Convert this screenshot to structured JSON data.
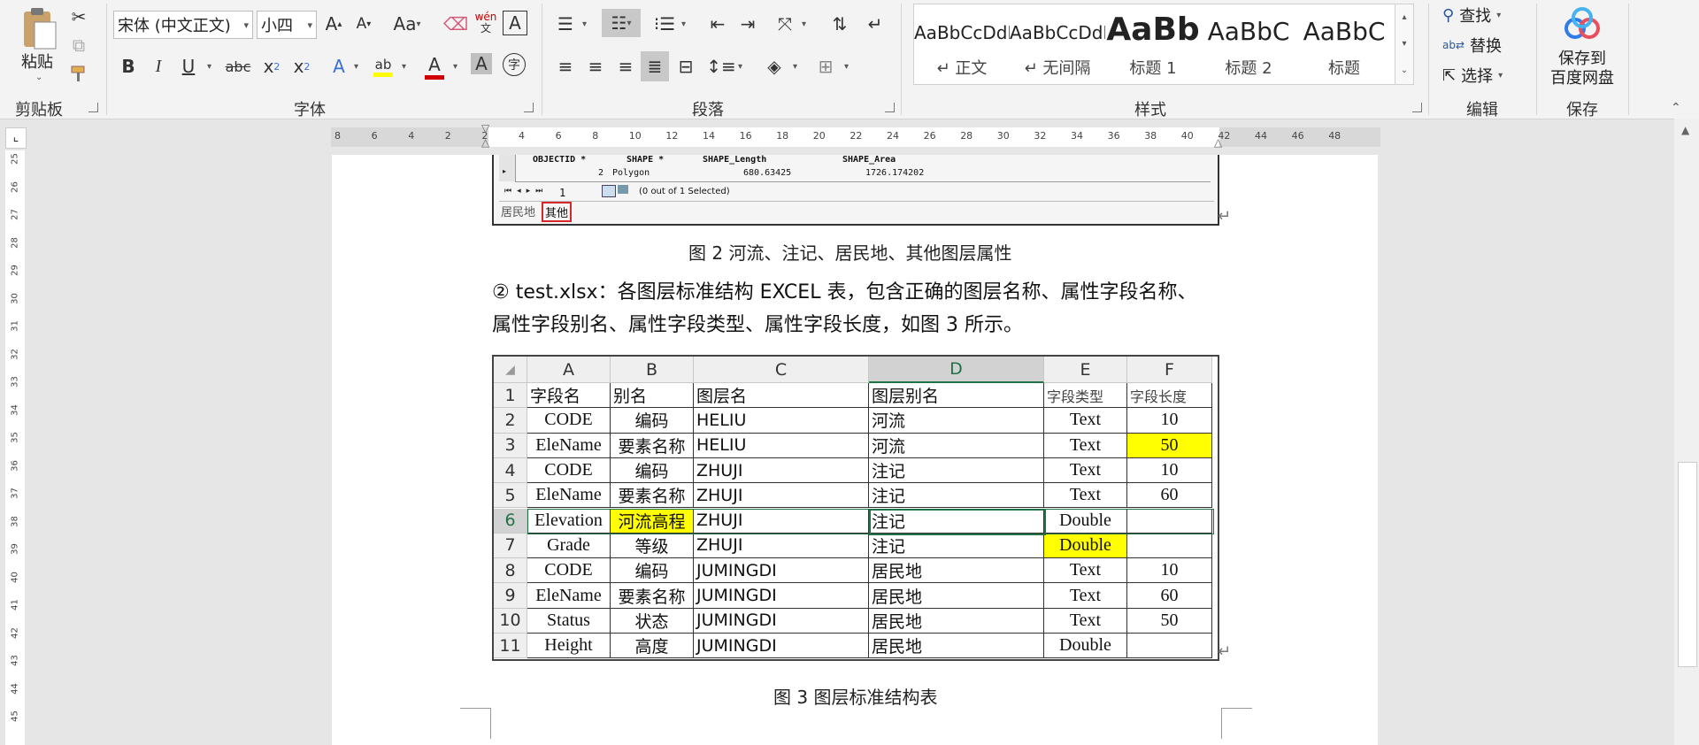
{
  "ribbon": {
    "clipboard": {
      "paste": "粘贴",
      "label": "剪贴板"
    },
    "font": {
      "name": "宋体 (中文正文)",
      "size": "小四",
      "label": "字体",
      "grow": "A",
      "shrink": "A",
      "case": "Aa",
      "phonetic": "wén",
      "border_char": "A",
      "bold": "B",
      "italic": "I",
      "underline": "U",
      "strike": "abc",
      "sub": "x",
      "sub_index": "2",
      "sup": "x",
      "sup_index": "2",
      "text_effect": "A",
      "highlight": "ab",
      "font_color": "A",
      "shading": "A",
      "enclose": "字"
    },
    "paragraph": {
      "label": "段落"
    },
    "styles": {
      "label": "样式",
      "items": [
        {
          "sample": "AaBbCcDdI",
          "name": "↵ 正文"
        },
        {
          "sample": "AaBbCcDdI",
          "name": "↵ 无间隔"
        },
        {
          "sample": "AaBb",
          "name": "标题 1"
        },
        {
          "sample": "AaBbC",
          "name": "标题 2"
        },
        {
          "sample": "AaBbC",
          "name": "标题"
        }
      ]
    },
    "editing": {
      "label": "编辑",
      "find": "查找",
      "replace": "替换",
      "select": "选择"
    },
    "save": {
      "label": "保存",
      "button_line1": "保存到",
      "button_line2": "百度网盘"
    }
  },
  "ruler": {
    "h_ticks": [
      "8",
      "6",
      "4",
      "2",
      "2",
      "4",
      "6",
      "8",
      "10",
      "12",
      "14",
      "16",
      "18",
      "20",
      "22",
      "24",
      "26",
      "28",
      "30",
      "32",
      "34",
      "36",
      "38",
      "40",
      "42",
      "44",
      "46",
      "48"
    ],
    "v_ticks": [
      "25",
      "26",
      "27",
      "28",
      "29",
      "30",
      "31",
      "32",
      "33",
      "34",
      "35",
      "36",
      "37",
      "38",
      "39",
      "40",
      "41",
      "42",
      "43",
      "44",
      "45"
    ]
  },
  "gis_table": {
    "headers": [
      "OBJECTID *",
      "SHAPE *",
      "SHAPE_Length",
      "SHAPE_Area"
    ],
    "row": [
      "2",
      "Polygon",
      "680.63425",
      "1726.174202"
    ],
    "nav_page": "1",
    "selection": "(0 out of 1 Selected)",
    "tabs": [
      "居民地",
      "其他"
    ]
  },
  "document": {
    "caption2": "图 2  河流、注记、居民地、其他图层属性",
    "para_line1": "② test.xlsx：各图层标准结构 EXCEL 表，包含正确的图层名称、属性字段名称、",
    "para_line2": "属性字段别名、属性字段类型、属性字段长度，如图 3 所示。",
    "caption3": "图 3 图层标准结构表",
    "para_mark": "↵"
  },
  "sheet": {
    "columns": [
      "A",
      "B",
      "C",
      "D",
      "E",
      "F"
    ],
    "rows": [
      {
        "n": "1",
        "cells": [
          "字段名",
          "别名",
          "图层名",
          "图层别名",
          "字段类型",
          "字段长度"
        ]
      },
      {
        "n": "2",
        "cells": [
          "CODE",
          "编码",
          "HELIU",
          "河流",
          "Text",
          "10"
        ]
      },
      {
        "n": "3",
        "cells": [
          "EleName",
          "要素名称",
          "HELIU",
          "河流",
          "Text",
          "50"
        ]
      },
      {
        "n": "4",
        "cells": [
          "CODE",
          "编码",
          "ZHUJI",
          "注记",
          "Text",
          "10"
        ]
      },
      {
        "n": "5",
        "cells": [
          "EleName",
          "要素名称",
          "ZHUJI",
          "注记",
          "Text",
          "60"
        ]
      },
      {
        "n": "6",
        "cells": [
          "Elevation",
          "河流高程",
          "ZHUJI",
          "注记",
          "Double",
          ""
        ]
      },
      {
        "n": "7",
        "cells": [
          "Grade",
          "等级",
          "ZHUJI",
          "注记",
          "Double",
          ""
        ]
      },
      {
        "n": "8",
        "cells": [
          "CODE",
          "编码",
          "JUMINGDI",
          "居民地",
          "Text",
          "10"
        ]
      },
      {
        "n": "9",
        "cells": [
          "EleName",
          "要素名称",
          "JUMINGDI",
          "居民地",
          "Text",
          "60"
        ]
      },
      {
        "n": "10",
        "cells": [
          "Status",
          "状态",
          "JUMINGDI",
          "居民地",
          "Text",
          "50"
        ]
      },
      {
        "n": "11",
        "cells": [
          "Height",
          "高度",
          "JUMINGDI",
          "居民地",
          "Double",
          ""
        ]
      }
    ],
    "highlight_color": "#ffff00",
    "selected_color": "#217346"
  }
}
